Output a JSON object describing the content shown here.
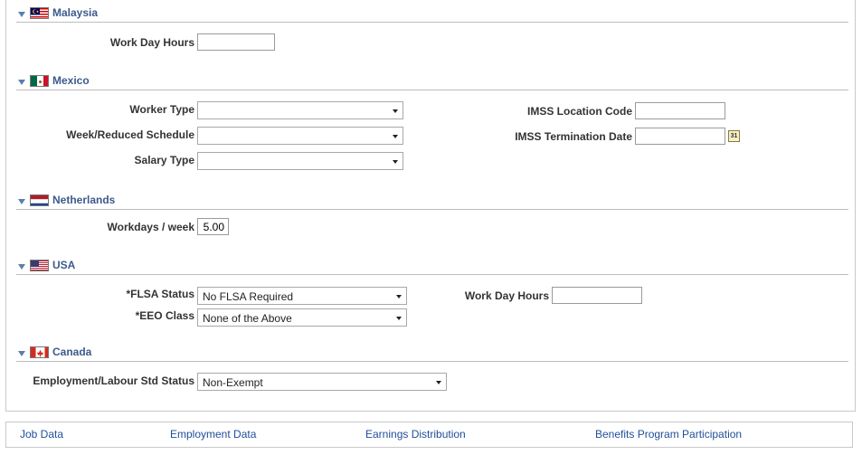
{
  "sections": {
    "malaysia": {
      "title": "Malaysia",
      "work_day_hours_label": "Work Day Hours",
      "work_day_hours_value": ""
    },
    "mexico": {
      "title": "Mexico",
      "worker_type_label": "Worker Type",
      "worker_type_value": "",
      "week_reduced_label": "Week/Reduced Schedule",
      "week_reduced_value": "",
      "salary_type_label": "Salary Type",
      "salary_type_value": "",
      "imss_location_label": "IMSS Location Code",
      "imss_location_value": "",
      "imss_termination_label": "IMSS Termination Date",
      "imss_termination_value": "",
      "calendar_icon_text": "31"
    },
    "netherlands": {
      "title": "Netherlands",
      "workdays_label": "Workdays / week",
      "workdays_value": "5.00"
    },
    "usa": {
      "title": "USA",
      "flsa_label": "*FLSA Status",
      "flsa_value": "No FLSA Required",
      "eeo_label": "*EEO Class",
      "eeo_value": "None of the Above",
      "work_day_hours_label": "Work Day Hours",
      "work_day_hours_value": ""
    },
    "canada": {
      "title": "Canada",
      "employment_label": "Employment/Labour Std Status",
      "employment_value": "Non-Exempt"
    }
  },
  "footer_links": {
    "job_data": "Job Data",
    "employment_data": "Employment Data",
    "earnings_distribution": "Earnings Distribution",
    "benefits_program": "Benefits Program Participation"
  },
  "colors": {
    "section_title": "#3c5a8c",
    "link": "#1f4e99",
    "border": "#c9c9c9"
  }
}
